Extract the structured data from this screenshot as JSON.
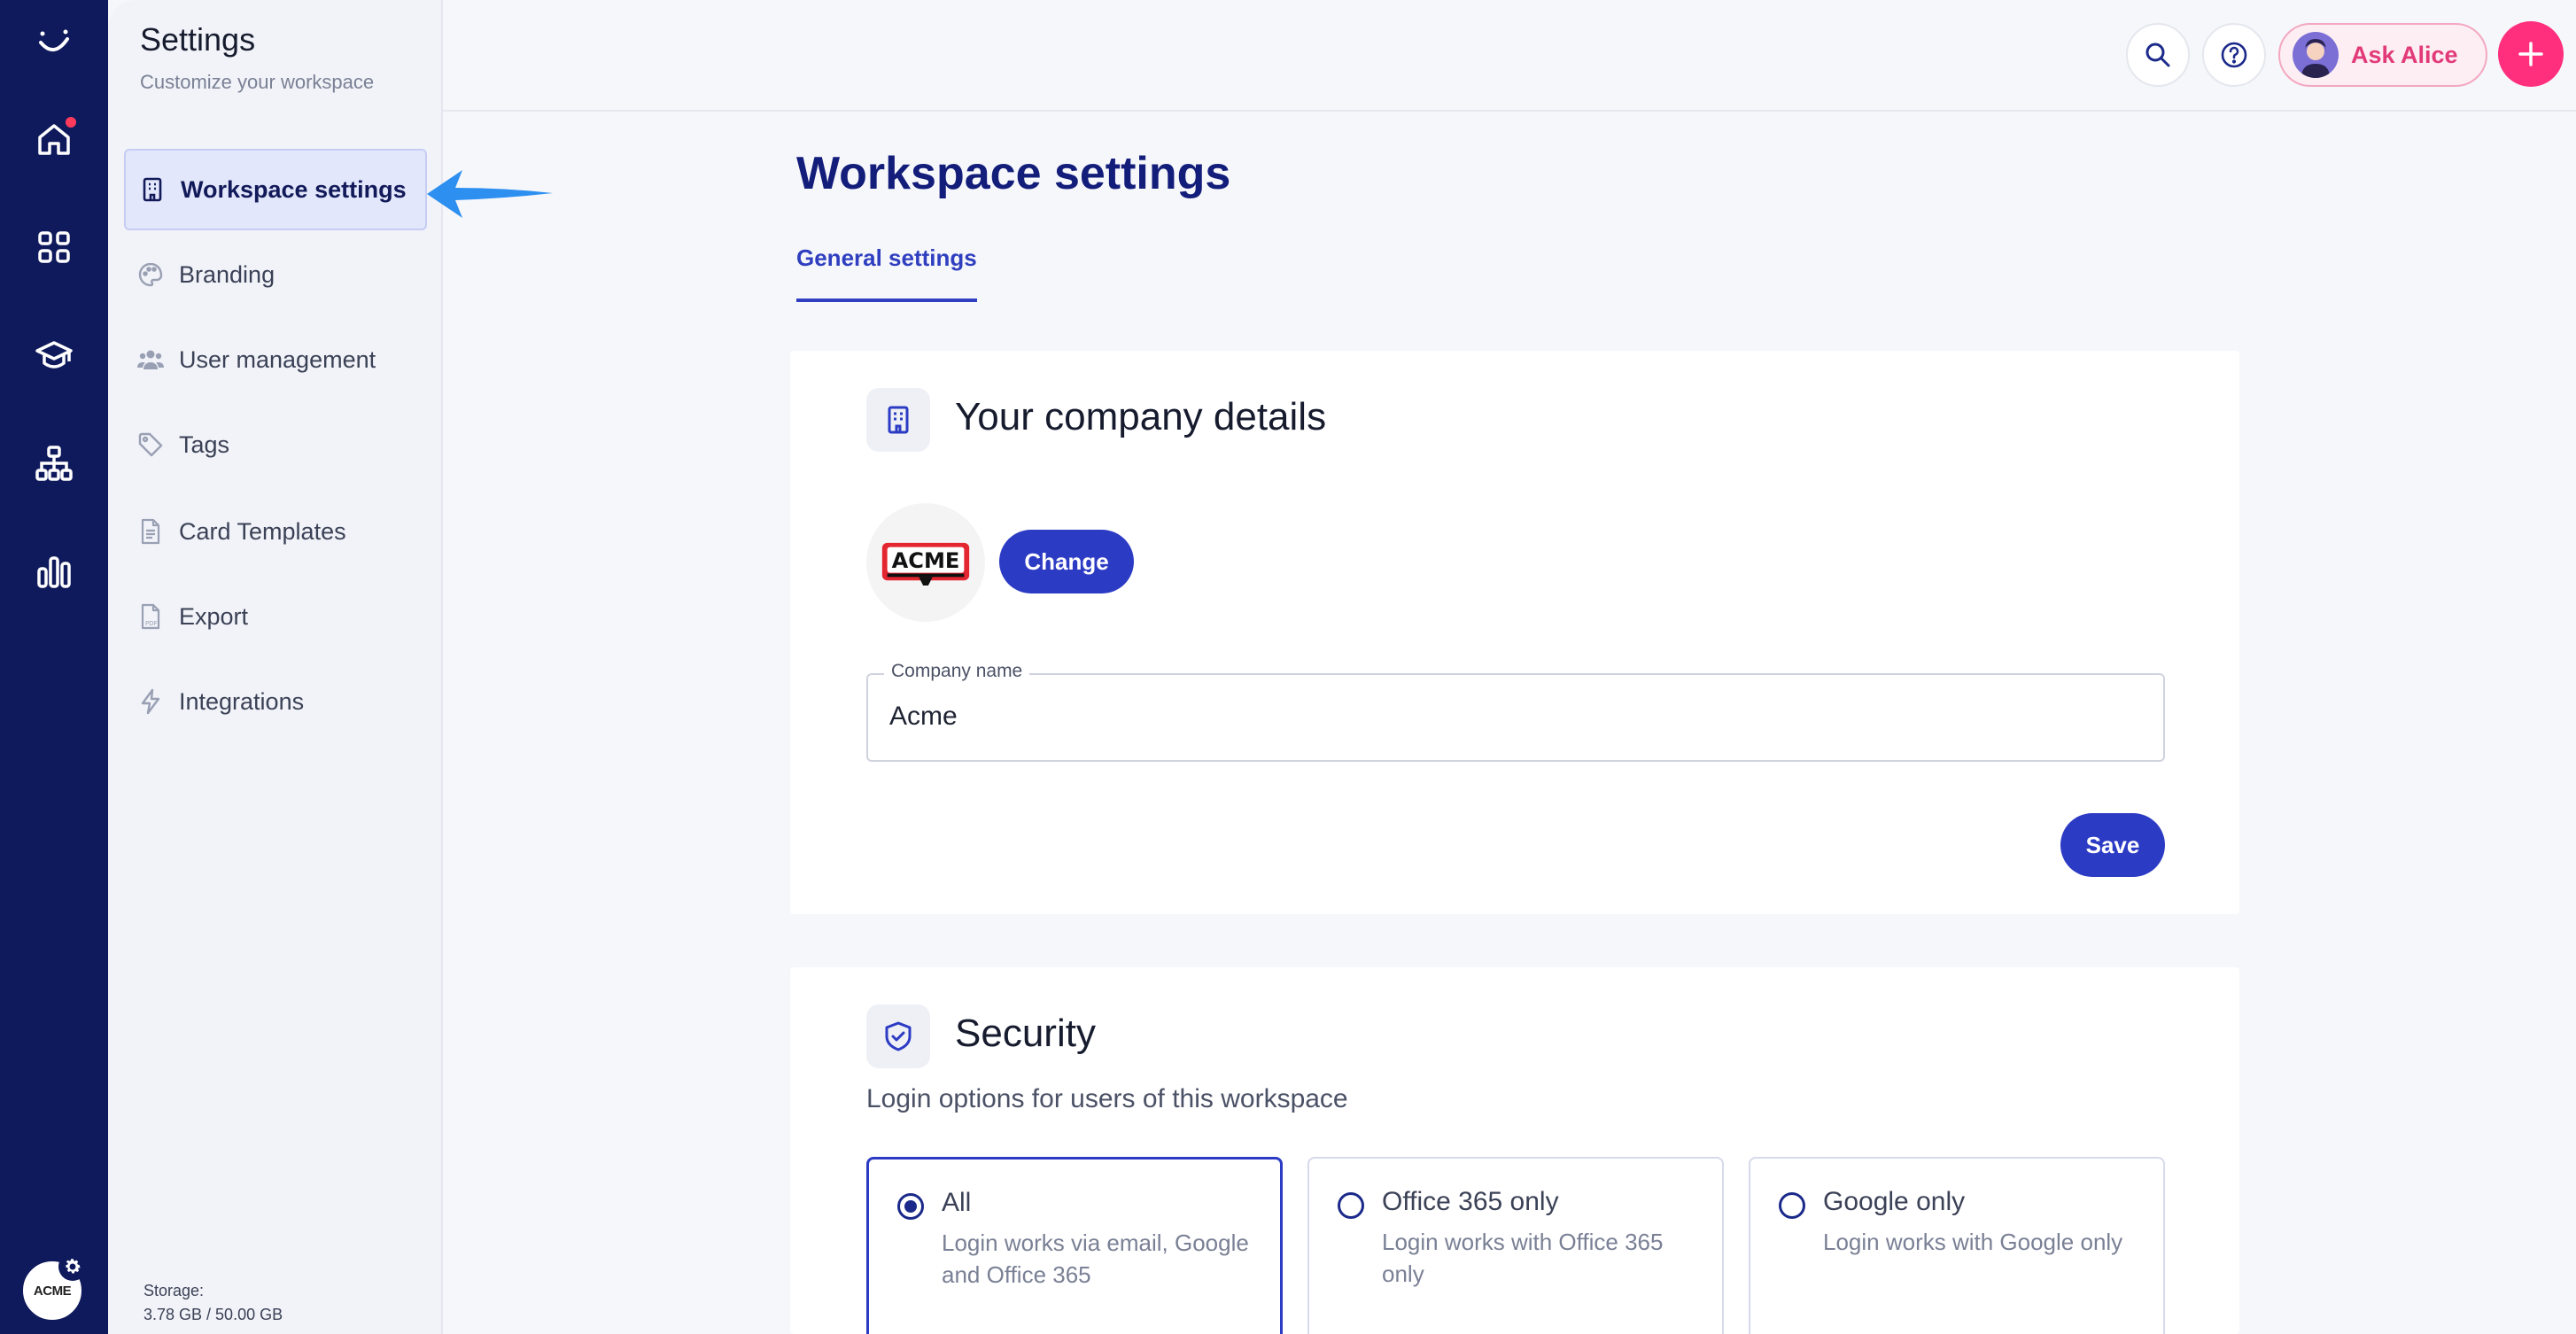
{
  "sidebar": {
    "title": "Settings",
    "subtitle": "Customize your workspace",
    "items": [
      {
        "label": "Workspace settings",
        "icon": "building-icon",
        "active": true
      },
      {
        "label": "Branding",
        "icon": "palette-icon"
      },
      {
        "label": "User management",
        "icon": "users-icon"
      },
      {
        "label": "Tags",
        "icon": "tag-icon"
      },
      {
        "label": "Card Templates",
        "icon": "document-icon"
      },
      {
        "label": "Export",
        "icon": "pdf-file-icon"
      },
      {
        "label": "Integrations",
        "icon": "lightning-icon"
      }
    ],
    "storage_label": "Storage:",
    "storage_value": "3.78 GB / 50.00 GB"
  },
  "rail": {
    "icons": [
      "logo-icon",
      "home-icon",
      "apps-grid-icon",
      "graduation-cap-icon",
      "org-chart-icon",
      "bar-chart-icon"
    ],
    "workspace_avatar_text": "ACME"
  },
  "topbar": {
    "ask_label": "Ask Alice"
  },
  "main": {
    "page_title": "Workspace settings",
    "tabs": [
      {
        "label": "General settings",
        "active": true
      }
    ],
    "company": {
      "title": "Your company details",
      "logo_text": "ACME",
      "change_label": "Change",
      "field_label": "Company name",
      "field_value": "Acme",
      "save_label": "Save"
    },
    "security": {
      "title": "Security",
      "subtitle": "Login options for users of this workspace",
      "options": [
        {
          "title": "All",
          "desc": "Login works via email, Google and Office 365",
          "selected": true
        },
        {
          "title": "Office 365 only",
          "desc": "Login works with Office 365 only",
          "selected": false
        },
        {
          "title": "Google only",
          "desc": "Login works with Google only",
          "selected": false
        }
      ]
    }
  },
  "colors": {
    "rail_bg": "#0f1a5c",
    "primary": "#2c3bc4",
    "title": "#131d7a",
    "accent_pink": "#ff2f7e",
    "annotation_arrow": "#2d8ff0"
  }
}
